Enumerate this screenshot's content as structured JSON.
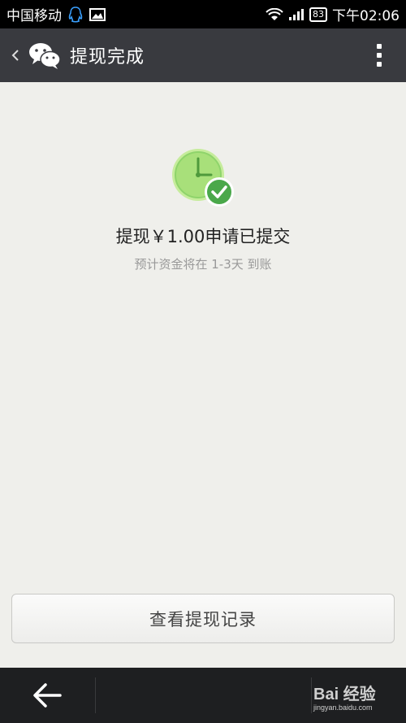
{
  "status_bar": {
    "carrier": "中国移动",
    "battery": "83",
    "time": "下午02:06"
  },
  "header": {
    "title": "提现完成"
  },
  "main": {
    "headline": "提现￥1.00申请已提交",
    "subline": "预计资金将在 1-3天 到账",
    "record_button_label": "查看提现记录"
  },
  "watermark": {
    "brand": "Bai 经验",
    "url": "jingyan.baidu.com"
  },
  "colors": {
    "header_bg": "#393a3f",
    "clock_green": "#8fd46b",
    "check_green": "#4aa84a"
  }
}
